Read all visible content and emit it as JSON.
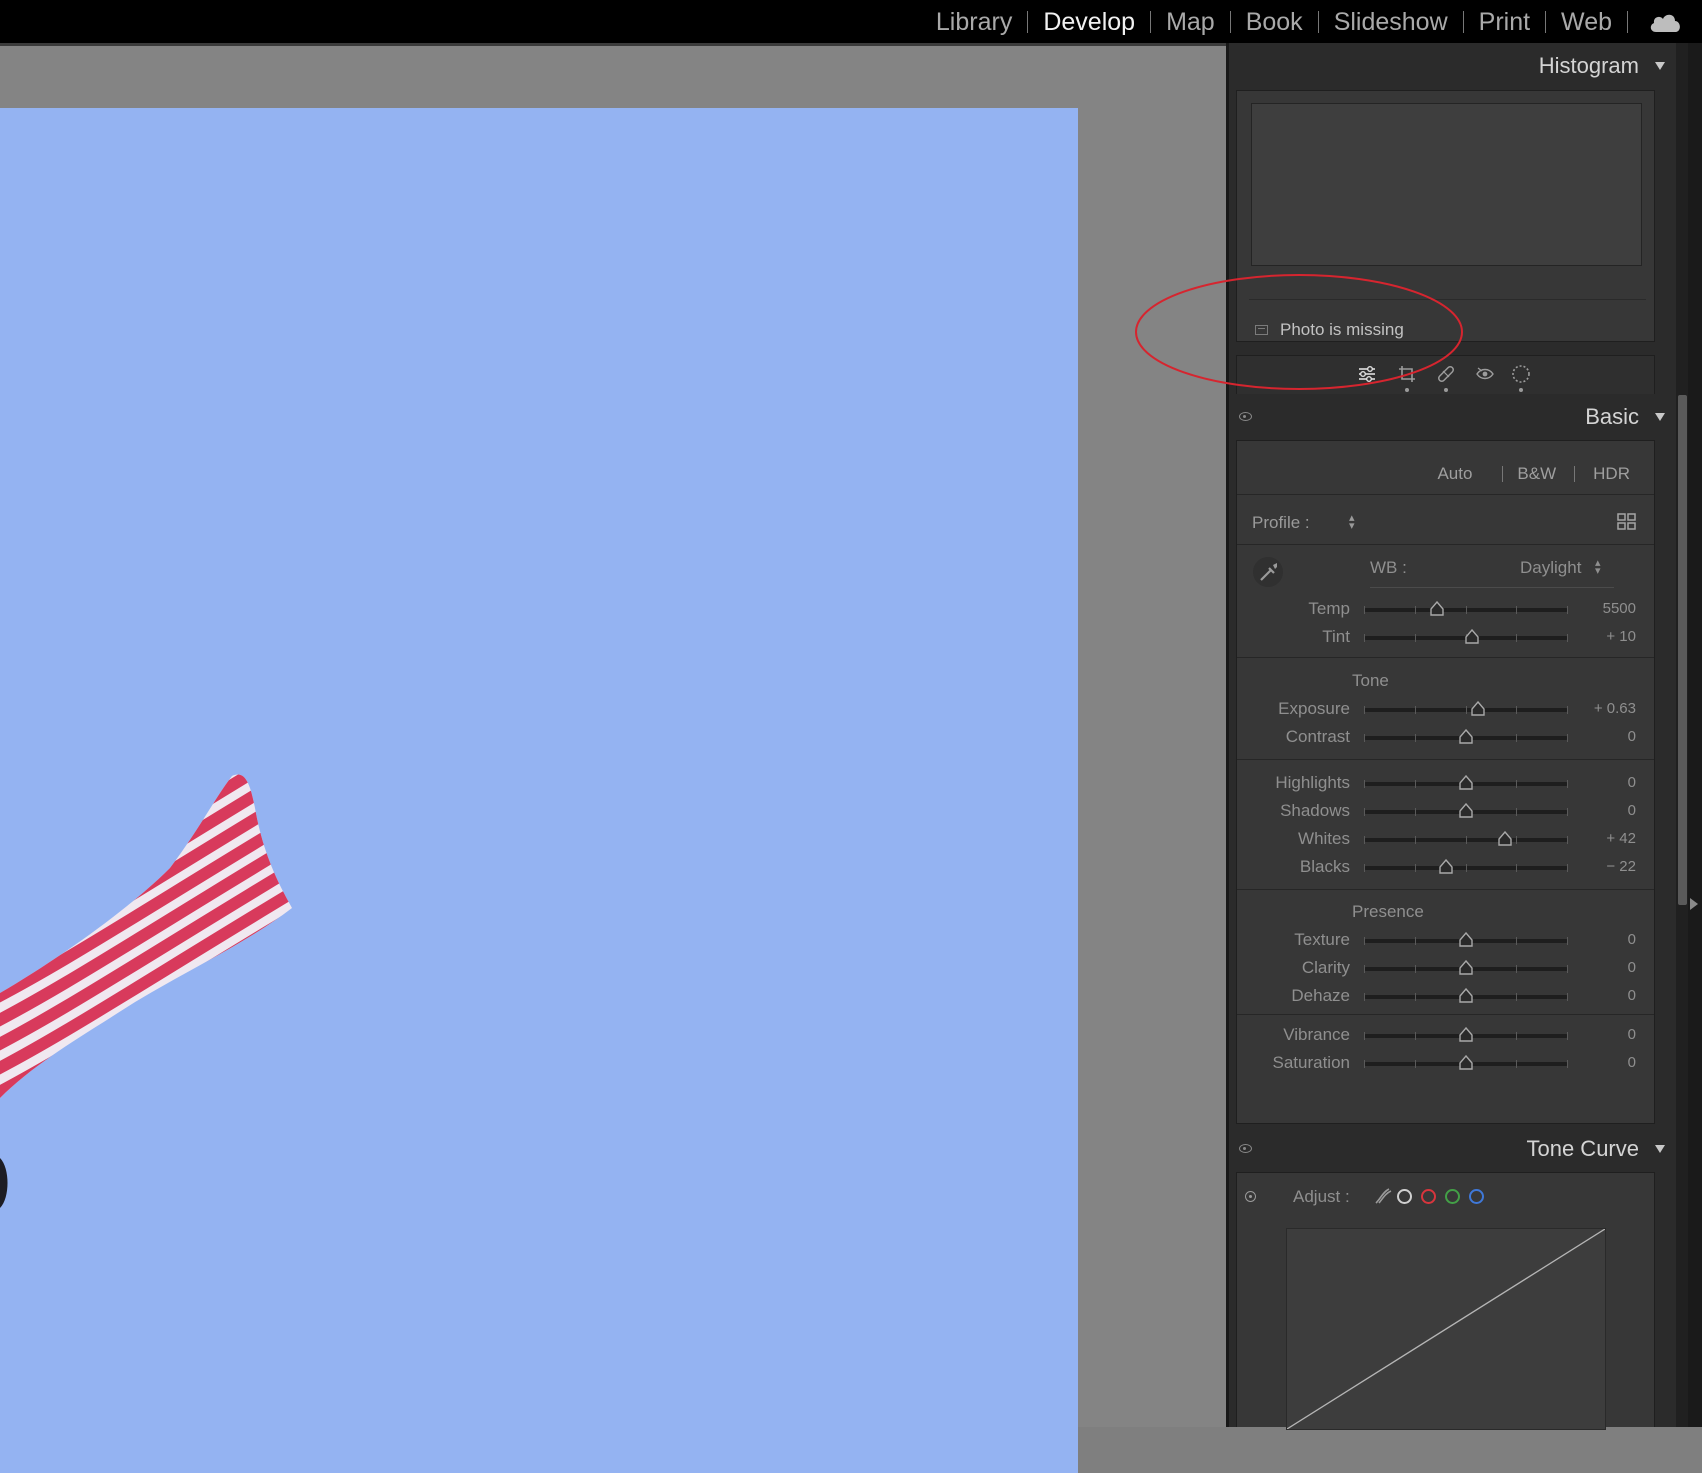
{
  "app": {
    "modules": [
      {
        "label": "Library",
        "active": false
      },
      {
        "label": "Develop",
        "active": true
      },
      {
        "label": "Map",
        "active": false
      },
      {
        "label": "Book",
        "active": false
      },
      {
        "label": "Slideshow",
        "active": false
      },
      {
        "label": "Print",
        "active": false
      },
      {
        "label": "Web",
        "active": false
      }
    ],
    "cloud_icon": "cloud-icon"
  },
  "colors": {
    "sky": "#94b3f2",
    "flag_red": "#d83a5c",
    "flag_white": "#f0e8f0",
    "annotation": "#d6252f"
  },
  "histogram": {
    "title": "Histogram",
    "status": "Photo is missing"
  },
  "tools": [
    "edit-sliders-icon",
    "crop-icon",
    "healing-icon",
    "red-eye-icon",
    "masking-icon"
  ],
  "basic": {
    "title": "Basic",
    "treatment": {
      "auto": "Auto",
      "bw": "B&W",
      "hdr": "HDR"
    },
    "profile_label": "Profile :",
    "wb_label": "WB :",
    "wb_value": "Daylight",
    "tone_title": "Tone",
    "presence_title": "Presence",
    "sliders": {
      "temp": {
        "label": "Temp",
        "value": "5500",
        "position": 0.36
      },
      "tint": {
        "label": "Tint",
        "value": "+ 10",
        "position": 0.53
      },
      "exposure": {
        "label": "Exposure",
        "value": "+ 0.63",
        "position": 0.56
      },
      "contrast": {
        "label": "Contrast",
        "value": "0",
        "position": 0.5
      },
      "highlights": {
        "label": "Highlights",
        "value": "0",
        "position": 0.5
      },
      "shadows": {
        "label": "Shadows",
        "value": "0",
        "position": 0.5
      },
      "whites": {
        "label": "Whites",
        "value": "+ 42",
        "position": 0.69
      },
      "blacks": {
        "label": "Blacks",
        "value": "− 22",
        "position": 0.4
      },
      "texture": {
        "label": "Texture",
        "value": "0",
        "position": 0.5
      },
      "clarity": {
        "label": "Clarity",
        "value": "0",
        "position": 0.5
      },
      "dehaze": {
        "label": "Dehaze",
        "value": "0",
        "position": 0.5
      },
      "vibrance": {
        "label": "Vibrance",
        "value": "0",
        "position": 0.5
      },
      "saturation": {
        "label": "Saturation",
        "value": "0",
        "position": 0.5
      }
    }
  },
  "tone_curve": {
    "title": "Tone Curve",
    "adjust_label": "Adjust :",
    "channels": [
      {
        "name": "rgb",
        "color": "#d0d0d0"
      },
      {
        "name": "red",
        "color": "#d8353d"
      },
      {
        "name": "green",
        "color": "#43a047"
      },
      {
        "name": "blue",
        "color": "#3f78d8"
      }
    ]
  }
}
